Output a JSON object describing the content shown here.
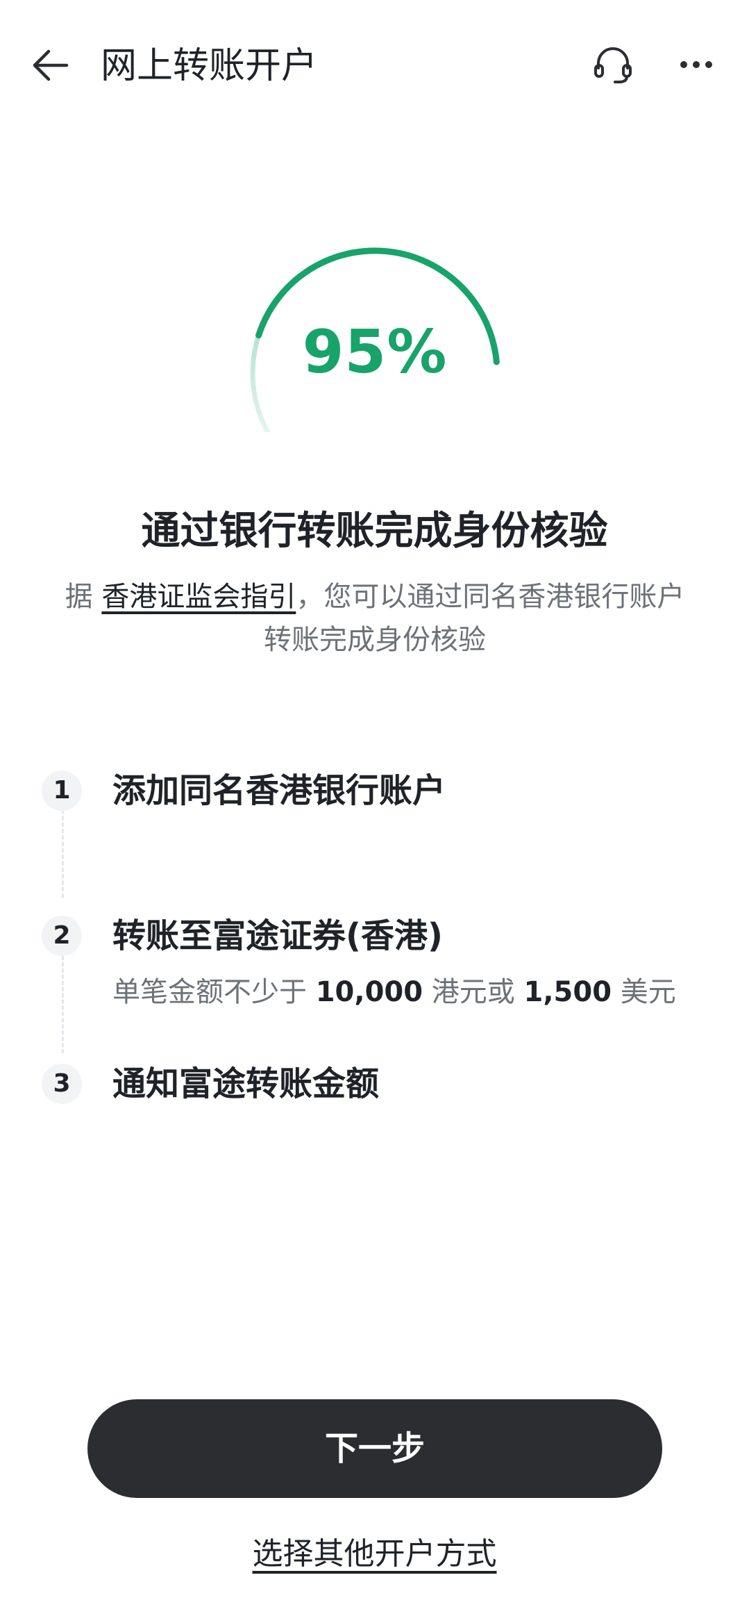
{
  "header": {
    "title": "网上转账开户",
    "icons": {
      "back": "arrow-left-icon",
      "support": "headset-icon",
      "more": "more-horizontal-icon"
    }
  },
  "progress": {
    "value": 95,
    "label": "95%",
    "color": "#18a36b"
  },
  "intro": {
    "headline": "通过银行转账完成身份核验",
    "sub_prefix": "据 ",
    "sub_link": "香港证监会指引",
    "sub_suffix": "，您可以通过同名香港银行账户转账完成身份核验"
  },
  "steps": [
    {
      "num": "1",
      "title": "添加同名香港银行账户"
    },
    {
      "num": "2",
      "title": "转账至富途证券(香港)",
      "desc": {
        "p1": "单笔金额不少于 ",
        "amount1": "10,000",
        "p2": " 港元或 ",
        "amount2": "1,500",
        "p3": " 美元"
      }
    },
    {
      "num": "3",
      "title": "通知富途转账金额"
    }
  ],
  "actions": {
    "next": "下一步",
    "other": "选择其他开户方式"
  },
  "colors": {
    "accent": "#18a36b",
    "button": "#2b2d31",
    "text": "#1f2329",
    "muted": "#6d7178"
  }
}
